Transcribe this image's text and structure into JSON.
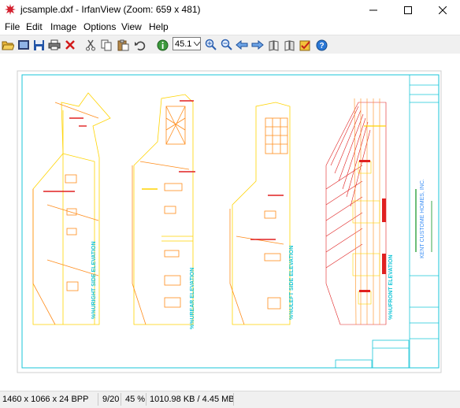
{
  "window": {
    "title": "jcsample.dxf - IrfanView (Zoom: 659 x 481)"
  },
  "menu": [
    "File",
    "Edit",
    "Image",
    "Options",
    "View",
    "Help"
  ],
  "toolbar": {
    "zoom_value": "45.1"
  },
  "drawing": {
    "elevations": [
      "%%URIGHT SIDE ELEVATION",
      "%%UREAR ELEVATION",
      "%%ULEFT SIDE ELEVATION",
      "%%UFRONT ELEVATION"
    ],
    "titleblock_company": "KENT CUSTOME HOMES, INC."
  },
  "status": {
    "dimensions": "1460 x 1066 x 24 BPP",
    "page": "9/20",
    "zoom": "45 %",
    "filesize": "1010.98 KB / 4.45 MB"
  },
  "colors": {
    "line": "#ffd400",
    "orange": "#ff8c1a",
    "red": "#e02020",
    "cyan": "#19c6d8",
    "blue": "#3a8ef5"
  }
}
